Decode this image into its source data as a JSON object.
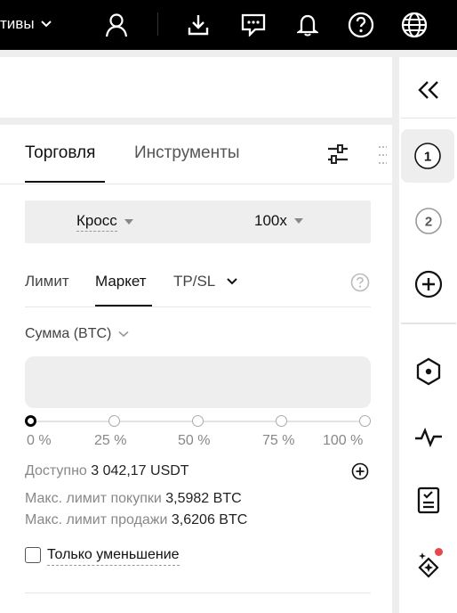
{
  "topbar": {
    "nav_label": "тивы",
    "icons": [
      "user-icon",
      "download-icon",
      "chat-icon",
      "bell-icon",
      "help-icon",
      "globe-icon"
    ]
  },
  "panel": {
    "tabs": [
      {
        "label": "Торговля",
        "active": true
      },
      {
        "label": "Инструменты",
        "active": false
      }
    ],
    "margin_mode": "Кросс",
    "leverage": "100x",
    "order_types": [
      {
        "label": "Лимит",
        "active": false
      },
      {
        "label": "Маркет",
        "active": true
      },
      {
        "label": "TP/SL",
        "active": false
      }
    ],
    "amount_label": "Сумма (BTC)",
    "amount_value": "",
    "slider": {
      "labels": [
        "0 %",
        "25 %",
        "50 %",
        "75 %",
        "100 %"
      ],
      "value_percent": 0
    },
    "available_label": "Доступно",
    "available_value": "3 042,17 USDT",
    "max_buy_label": "Макс. лимит покупки",
    "max_buy_value": "3,5982 BTC",
    "max_sell_label": "Макс. лимит продажи",
    "max_sell_value": "3,6206 BTC",
    "reduce_only_label": "Только уменьшение",
    "reduce_only_checked": false
  },
  "rail": {
    "steps": [
      {
        "label": "1",
        "active": true
      },
      {
        "label": "2",
        "active": false
      }
    ]
  },
  "colors": {
    "accent": "#000000",
    "panel_bg": "#eeeeee",
    "notification": "#e5484d"
  }
}
